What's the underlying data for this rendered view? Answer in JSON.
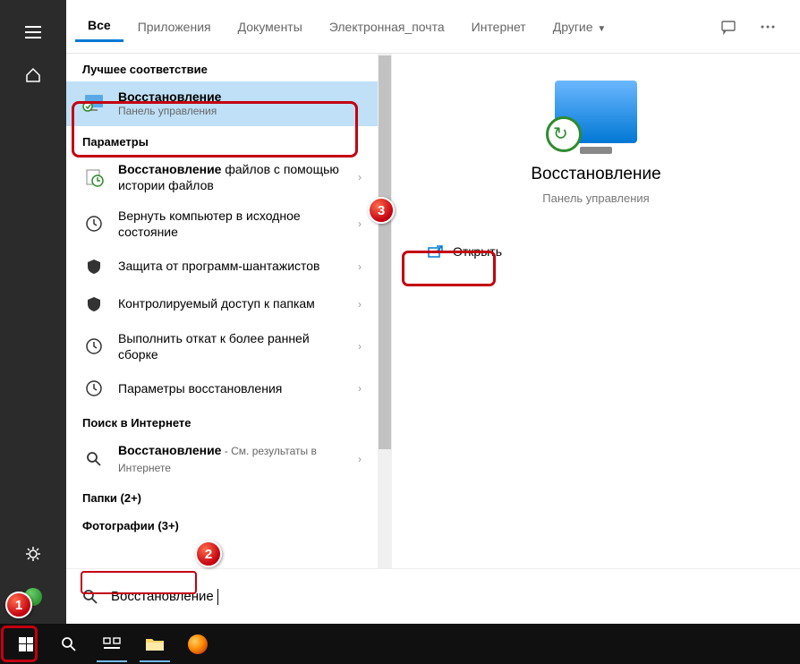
{
  "tabs": {
    "all": "Все",
    "apps": "Приложения",
    "docs": "Документы",
    "email": "Электронная_почта",
    "internet": "Интернет",
    "more": "Другие"
  },
  "categories": {
    "best_match": "Лучшее соответствие",
    "settings": "Параметры",
    "web": "Поиск в Интернете",
    "folders": "Папки (2+)",
    "photos": "Фотографии (3+)"
  },
  "best": {
    "title": "Восстановление",
    "subtitle": "Панель управления"
  },
  "settings_items": [
    {
      "strong": "Восстановление",
      "rest": " файлов с помощью истории файлов"
    },
    {
      "strong": "",
      "rest": "Вернуть компьютер в исходное состояние"
    },
    {
      "strong": "",
      "rest": "Защита от программ-шантажистов"
    },
    {
      "strong": "",
      "rest": "Контролируемый доступ к папкам"
    },
    {
      "strong": "",
      "rest": "Выполнить откат к более ранней сборке"
    },
    {
      "strong": "",
      "rest": "Параметры восстановления"
    }
  ],
  "web_item": {
    "strong": "Восстановление",
    "rest": " - См. результаты в Интернете"
  },
  "preview": {
    "title": "Восстановление",
    "subtitle": "Панель управления",
    "open": "Открыть"
  },
  "search_value": "Восстановление",
  "markers": {
    "m1": "1",
    "m2": "2",
    "m3": "3"
  }
}
